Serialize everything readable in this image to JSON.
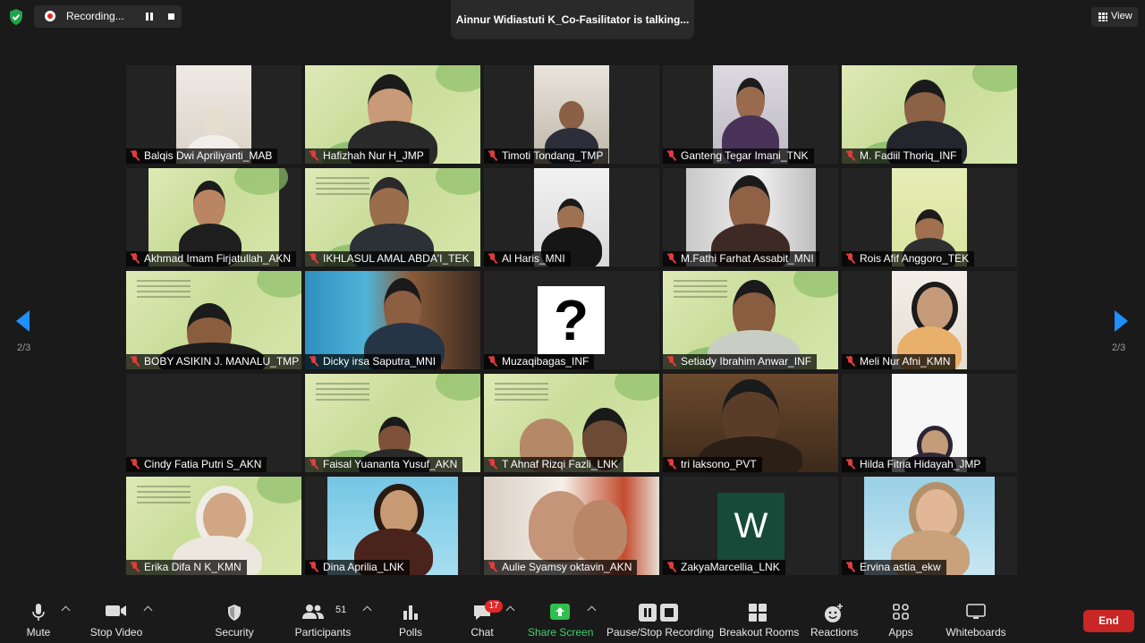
{
  "topbar": {
    "recording_label": "Recording...",
    "talking_text": "Ainnur Widiastuti K_Co-Fasilitator is talking...",
    "view_label": "View"
  },
  "gallery": {
    "participants": [
      {
        "name": "Balqis Dwi Apriliyanti_MAB"
      },
      {
        "name": "Hafizhah Nur H_JMP"
      },
      {
        "name": "Timoti Tondang_TMP"
      },
      {
        "name": "Ganteng Tegar Imani_TNK"
      },
      {
        "name": "M. Fadiil Thoriq_INF"
      },
      {
        "name": "Akhmad Imam Firjatullah_AKN"
      },
      {
        "name": "IKHLASUL AMAL ABDA'I_TEK"
      },
      {
        "name": "Al Haris_MNI"
      },
      {
        "name": "M.Fathi Farhat Assabit_MNI"
      },
      {
        "name": "Rois Afif Anggoro_TEK"
      },
      {
        "name": "BOBY ASIKIN J. MANALU_TMP"
      },
      {
        "name": "Dicky irsa Saputra_MNI"
      },
      {
        "name": "Muzaqibagas_INF"
      },
      {
        "name": "Setiady Ibrahim Anwar_INF"
      },
      {
        "name": "Meli Nur Afni_KMN"
      },
      {
        "name": "Cindy Fatia Putri S_AKN"
      },
      {
        "name": "Faisal Yuananta Yusuf_AKN"
      },
      {
        "name": "T Ahnaf Rizqi Fazli_LNK"
      },
      {
        "name": "tri laksono_PVT"
      },
      {
        "name": "Hilda Fitria Hidayah_JMP"
      },
      {
        "name": "Erika Difa N K_KMN"
      },
      {
        "name": "Dina Aprilia_LNK"
      },
      {
        "name": "Aulie Syamsy oktavin_AKN"
      },
      {
        "name": "ZakyaMarcellia_LNK"
      },
      {
        "name": "Ervina astia_ekw"
      }
    ],
    "avatar_letter": "W",
    "avatar_qmark": "?",
    "page_indicator": "2/3"
  },
  "toolbar": {
    "mute": "Mute",
    "stop_video": "Stop Video",
    "security": "Security",
    "participants": "Participants",
    "participants_count": "51",
    "polls": "Polls",
    "chat": "Chat",
    "chat_badge": "17",
    "share_screen": "Share Screen",
    "pause_stop_recording": "Pause/Stop Recording",
    "breakout_rooms": "Breakout Rooms",
    "reactions": "Reactions",
    "apps": "Apps",
    "whiteboards": "Whiteboards",
    "end": "End"
  },
  "colors": {
    "accent_blue": "#1e90ff",
    "end_red": "#c92626",
    "share_green": "#3fd26a",
    "active_speaker": "#8fd16a",
    "background": "#1a1a1a"
  }
}
